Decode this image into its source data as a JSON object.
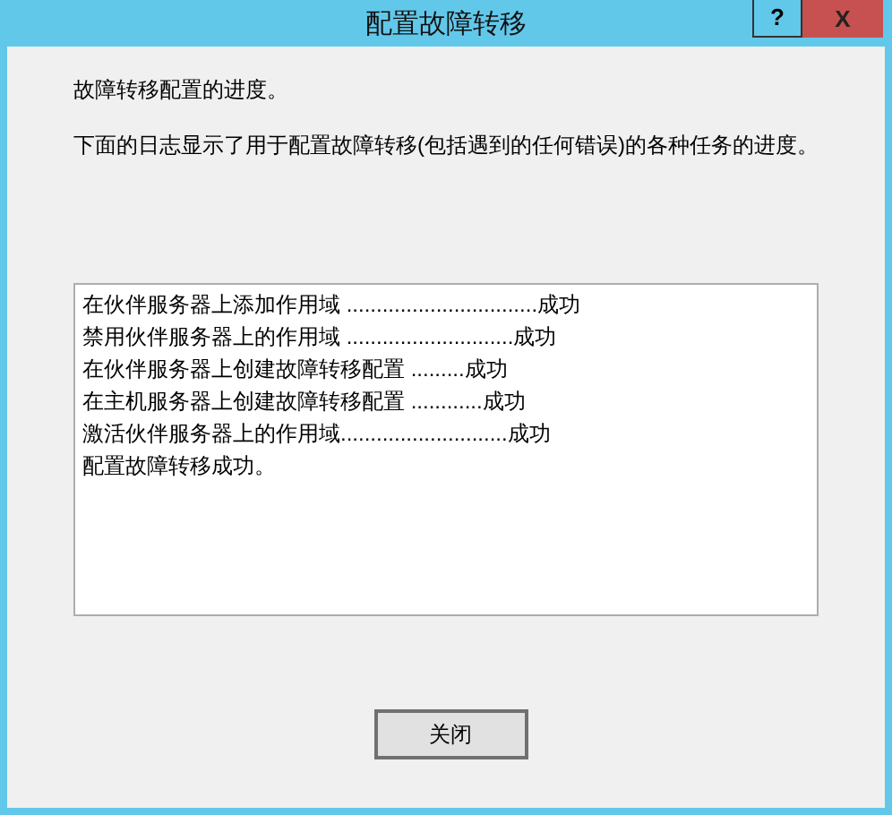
{
  "window": {
    "title": "配置故障转移",
    "help_button": "?",
    "close_button": "X"
  },
  "heading": "故障转移配置的进度。",
  "description": "下面的日志显示了用于配置故障转移(包括遇到的任何错误)的各种任务的进度。",
  "log": [
    "在伙伴服务器上添加作用域 ................................成功",
    "禁用伙伴服务器上的作用域 ............................成功",
    "在伙伴服务器上创建故障转移配置 .........成功",
    "在主机服务器上创建故障转移配置 ............成功",
    "激活伙伴服务器上的作用域............................成功",
    "配置故障转移成功。"
  ],
  "buttons": [
    "关闭"
  ]
}
